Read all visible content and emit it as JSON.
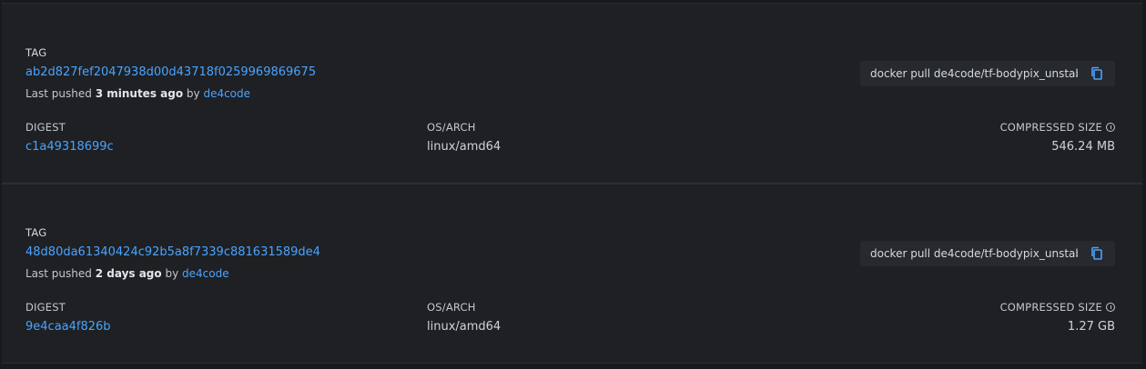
{
  "labels": {
    "tag": "TAG",
    "digest": "DIGEST",
    "os_arch": "OS/ARCH",
    "compressed_size": "COMPRESSED SIZE",
    "last_pushed_prefix": "Last pushed",
    "by": "by"
  },
  "tags": [
    {
      "hash": "ab2d827fef2047938d00d43718f0259969869675",
      "pushed_ago": "3 minutes ago",
      "pushed_by": "de4code",
      "pull_command": "docker pull de4code/tf-bodypix_unstable",
      "digest": "c1a49318699c",
      "os_arch": "linux/amd64",
      "size": "546.24 MB"
    },
    {
      "hash": "48d80da61340424c92b5a8f7339c881631589de4",
      "pushed_ago": "2 days ago",
      "pushed_by": "de4code",
      "pull_command": "docker pull de4code/tf-bodypix_unstable",
      "digest": "9e4caa4f826b",
      "os_arch": "linux/amd64",
      "size": "1.27 GB"
    }
  ],
  "icons": {
    "copy": "copy-icon",
    "info": "info-icon"
  },
  "colors": {
    "link": "#4aa3ff",
    "background": "#1e2024"
  }
}
